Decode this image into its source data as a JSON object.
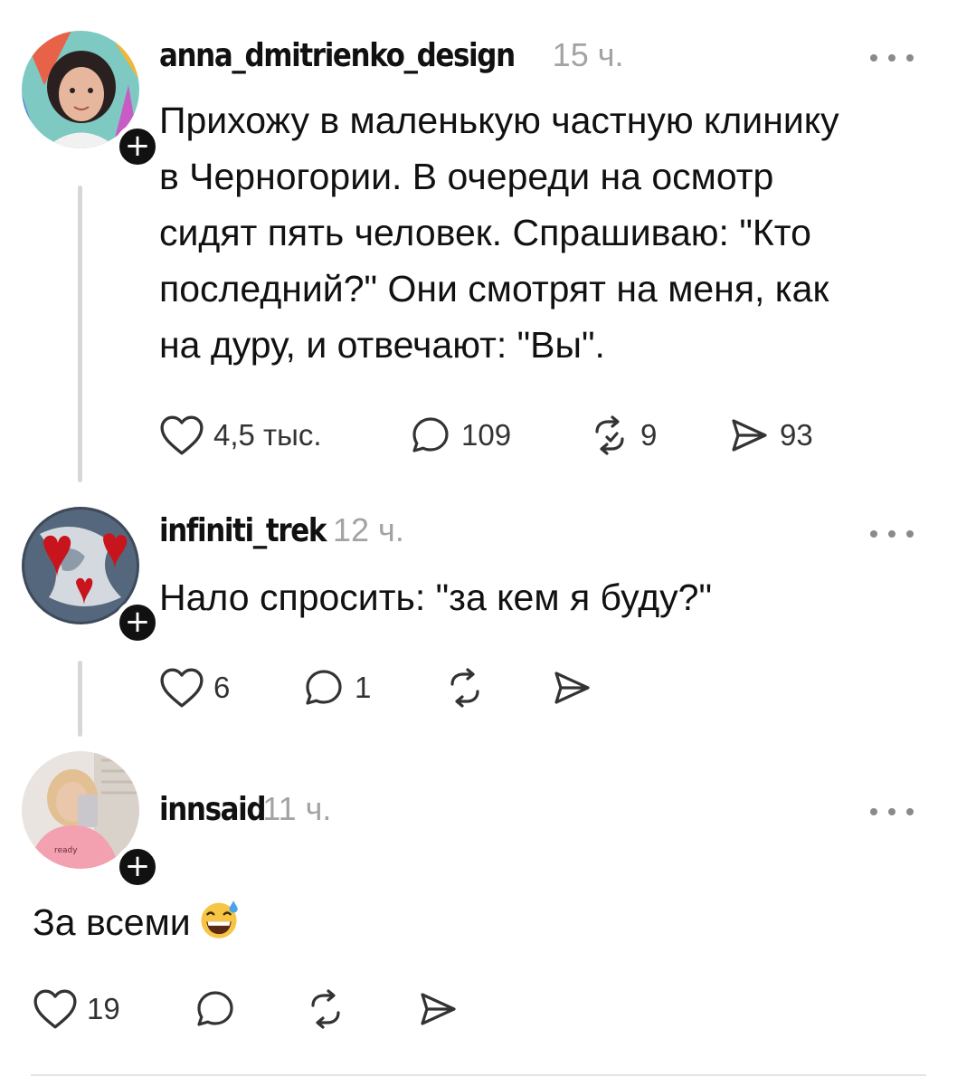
{
  "posts": [
    {
      "username": "anna_dmitrienko_design",
      "time": "15 ч.",
      "text_lines": [
        "Прихожу в маленькую частную клинику",
        "в Черногории. В очереди на осмотр",
        "сидят пять человек. Спрашиваю: \"Кто",
        "последний?\" Они смотрят на меня, как",
        "на дуру, и отвечают: \"Вы\"."
      ],
      "likes": "4,5 тыс.",
      "replies": "109",
      "reposts": "9",
      "shares": "93"
    },
    {
      "username": "infiniti_trek",
      "time": "12 ч.",
      "text_lines": [
        "Нало спросить: \"за кем я буду?\""
      ],
      "likes": "6",
      "replies": "1",
      "reposts": "",
      "shares": ""
    },
    {
      "username": "innsaid",
      "time": "11 ч.",
      "text_lines": [
        "За всеми"
      ],
      "emoji": "grinning-sweat-emoji",
      "likes": "19",
      "replies": "",
      "reposts": "",
      "shares": ""
    }
  ],
  "icons": {
    "like": "heart-icon",
    "reply": "speech-bubble-icon",
    "repost": "repost-icon",
    "share": "send-icon",
    "more": "more-icon",
    "follow": "plus-icon"
  },
  "follow_symbol": "+",
  "colors": {
    "text": "#111111",
    "muted": "#a3a3a3",
    "thread_line": "#d7d7d7",
    "icon": "#333333"
  }
}
